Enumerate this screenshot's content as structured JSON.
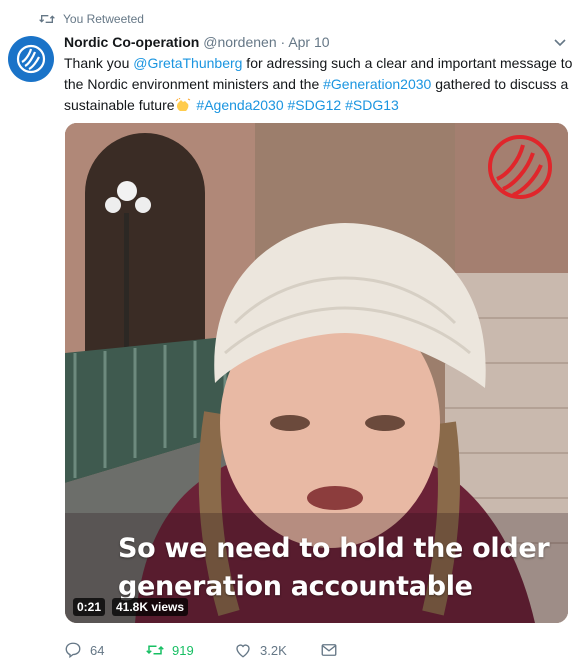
{
  "retweet_context": {
    "label": "You Retweeted"
  },
  "author": {
    "name": "Nordic Co-operation",
    "handle": "@nordenen",
    "separator": "·",
    "date": "Apr 10"
  },
  "tweet": {
    "text_1": "Thank you ",
    "mention": "@GretaThunberg",
    "text_2": " for adressing such a clear and important message to the Nordic environment ministers and the ",
    "hashtag_1": "#Generation2030",
    "text_3": " gathered to discuss a sustainable future",
    "emoji": "clapping-hands",
    "hashtags": [
      "#Agenda2030",
      "#SDG12",
      "#SDG13"
    ]
  },
  "video": {
    "caption_line_1": "So we need to hold the older",
    "caption_line_2": "generation accountable",
    "duration": "0:21",
    "views": "41.8K views"
  },
  "actions": {
    "replies": "64",
    "retweets": "919",
    "likes": "3.2K"
  },
  "colors": {
    "link": "#1b95e0",
    "retweet_active": "#17bf63",
    "muted": "#657786",
    "avatar_bg": "#1a73c8",
    "watermark": "#e0262b"
  }
}
